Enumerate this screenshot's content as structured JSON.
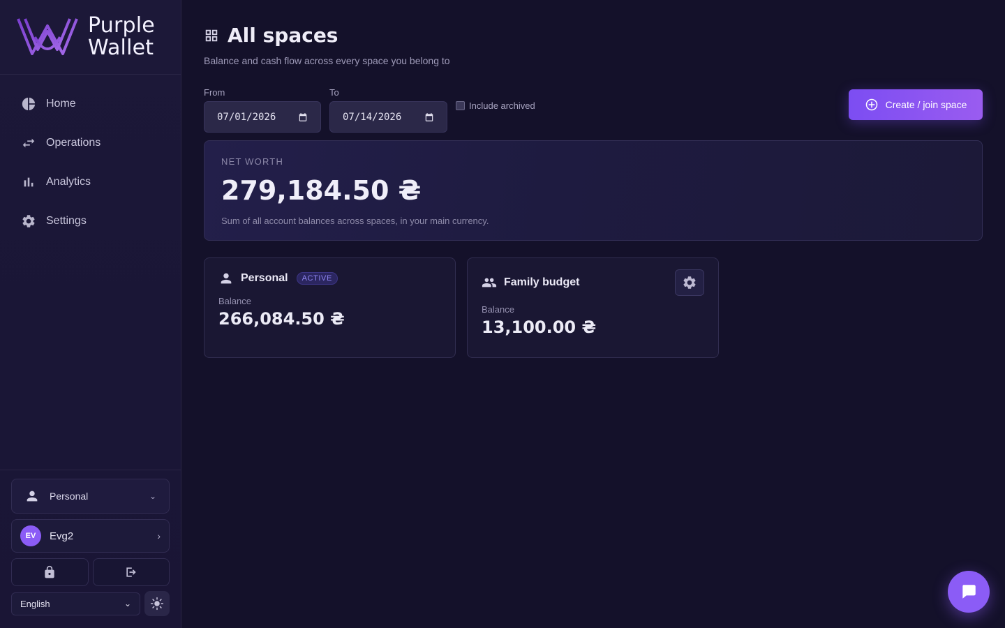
{
  "brand": {
    "line1": "Purple",
    "line2": "Wallet"
  },
  "nav": [
    {
      "label": "Home",
      "icon": "pie-chart-icon"
    },
    {
      "label": "Operations",
      "icon": "swap-arrows-icon"
    },
    {
      "label": "Analytics",
      "icon": "bar-chart-icon"
    },
    {
      "label": "Settings",
      "icon": "gear-icon"
    }
  ],
  "footer": {
    "space_selector": "Personal",
    "user": {
      "initials": "EV",
      "name": "Evg2"
    },
    "language": "English"
  },
  "main": {
    "title": "All spaces",
    "subtitle": "Balance and cash flow across every space you belong to",
    "filters": {
      "from_label": "From",
      "from_value": "07/01/2026",
      "to_label": "To",
      "to_value": "07/14/2026",
      "archived_label": "Include archived"
    },
    "create_button": "Create / join space",
    "net_worth": {
      "label": "NET WORTH",
      "value": "279,184.50 ₴",
      "note": "Sum of all account balances across spaces, in your main currency."
    },
    "spaces": [
      {
        "name": "Personal",
        "badge": "ACTIVE",
        "balance_label": "Balance",
        "balance": "266,084.50 ₴"
      },
      {
        "name": "Family budget",
        "balance_label": "Balance",
        "balance": "13,100.00 ₴"
      }
    ]
  },
  "colors": {
    "accent": "#8b5cf6",
    "background": "#14112a",
    "sidebar": "#1c1838"
  }
}
